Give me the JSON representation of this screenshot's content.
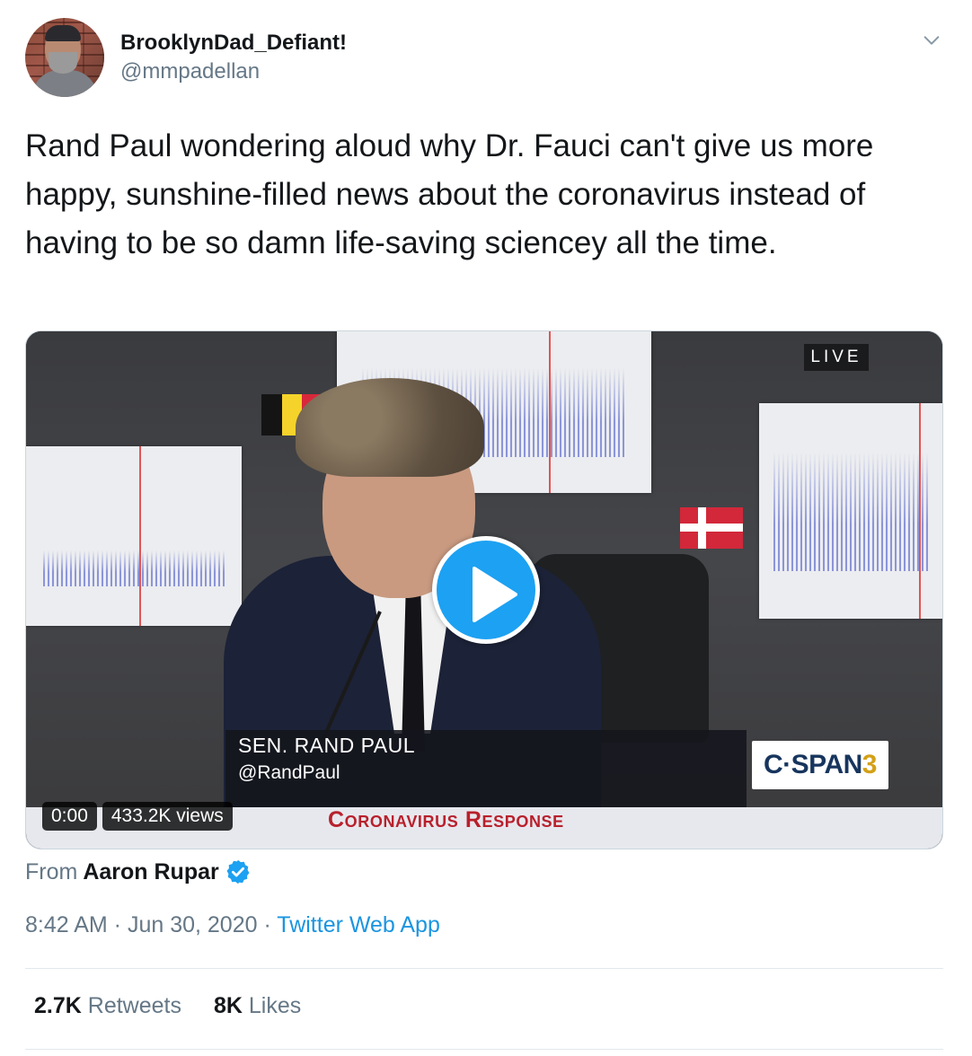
{
  "user": {
    "display_name": "BrooklynDad_Defiant!",
    "handle": "@mmpadellan"
  },
  "tweet": {
    "text": "Rand Paul wondering aloud why Dr. Fauci can't give us more happy, sunshine-filled news about the coronavirus instead of having to be so damn life-saving sciencey all the time."
  },
  "video": {
    "live_label": "LIVE",
    "chyron_name": "SEN. RAND PAUL",
    "chyron_handle": "@RandPaul",
    "network_logo_main": "C·SPAN",
    "network_logo_num": "3",
    "lower_banner": "Coronavirus Response",
    "time": "0:00",
    "views": "433.2K views"
  },
  "attribution": {
    "prefix": "From",
    "author": "Aaron Rupar"
  },
  "meta": {
    "time": "8:42 AM",
    "separator": " · ",
    "date": "Jun 30, 2020",
    "source": "Twitter Web App"
  },
  "stats": {
    "retweets_count": "2.7K",
    "retweets_label": "Retweets",
    "likes_count": "8K",
    "likes_label": "Likes"
  },
  "icons": {
    "menu": "chevron-down-icon",
    "play": "play-icon",
    "verified": "verified-badge-icon"
  },
  "colors": {
    "accent": "#1da1f2",
    "link": "#1b95e0",
    "secondary_text": "#657786"
  }
}
